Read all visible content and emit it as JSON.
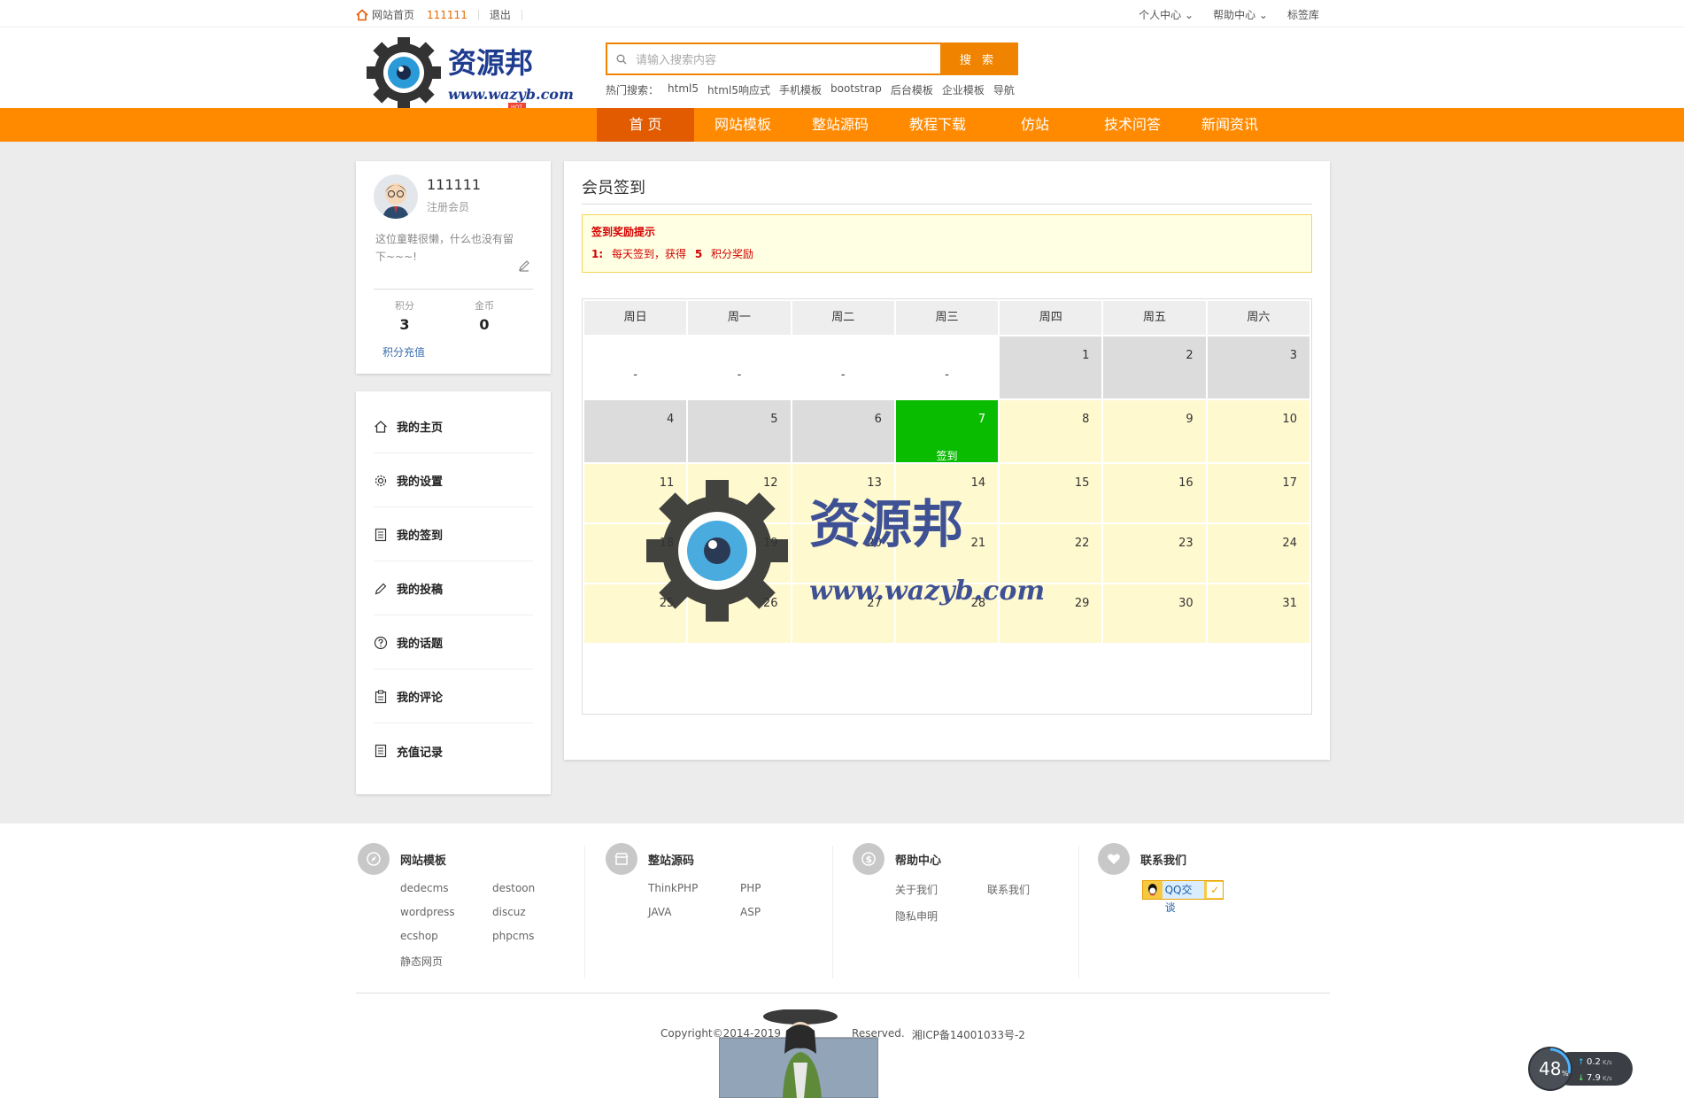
{
  "topbar": {
    "home": "网站首页",
    "user": "111111",
    "logout": "退出",
    "personal_center": "个人中心",
    "help_center": "帮助中心",
    "tag_library": "标签库"
  },
  "search": {
    "placeholder": "请输入搜索内容",
    "button": "搜 索",
    "hot_label": "热门搜索：",
    "hot_terms": [
      "html5",
      "html5响应式",
      "手机模板",
      "bootstrap",
      "后台模板",
      "企业模板",
      "导航"
    ]
  },
  "logo": {
    "text": "资源邦",
    "url_text": "www.wazyb.com",
    "badge": "HOT"
  },
  "nav": [
    "首 页",
    "网站模板",
    "整站源码",
    "教程下载",
    "仿站",
    "技术问答",
    "新闻资讯"
  ],
  "profile": {
    "name": "111111",
    "role": "注册会员",
    "bio": "这位童鞋很懒，什么也没有留下~~~!",
    "points_label": "积分",
    "points": "3",
    "coins_label": "金币",
    "coins": "0",
    "recharge": "积分充值"
  },
  "menu": [
    {
      "label": "我的主页",
      "icon": "home-icon"
    },
    {
      "label": "我的设置",
      "icon": "gear-icon"
    },
    {
      "label": "我的签到",
      "icon": "list-icon"
    },
    {
      "label": "我的投稿",
      "icon": "pencil-icon"
    },
    {
      "label": "我的话题",
      "icon": "question-icon"
    },
    {
      "label": "我的评论",
      "icon": "clipboard-icon"
    },
    {
      "label": "充值记录",
      "icon": "list-icon"
    }
  ],
  "main": {
    "title": "会员签到",
    "tips_title": "签到奖励提示",
    "tips_prefix": "1:",
    "tips_text_a": "每天签到，获得",
    "tips_points": "5",
    "tips_text_b": "积分奖励"
  },
  "calendar": {
    "weekdays": [
      "周日",
      "周一",
      "周二",
      "周三",
      "周四",
      "周五",
      "周六"
    ],
    "rows": [
      [
        {
          "t": "-",
          "s": "empty"
        },
        {
          "t": "-",
          "s": "empty"
        },
        {
          "t": "-",
          "s": "empty"
        },
        {
          "t": "-",
          "s": "empty"
        },
        {
          "t": "1",
          "s": "past"
        },
        {
          "t": "2",
          "s": "past"
        },
        {
          "t": "3",
          "s": "past"
        }
      ],
      [
        {
          "t": "4",
          "s": "past"
        },
        {
          "t": "5",
          "s": "past"
        },
        {
          "t": "6",
          "s": "past"
        },
        {
          "t": "7",
          "s": "today",
          "sign": "签到"
        },
        {
          "t": "8",
          "s": "future"
        },
        {
          "t": "9",
          "s": "future"
        },
        {
          "t": "10",
          "s": "future"
        }
      ],
      [
        {
          "t": "11",
          "s": "future"
        },
        {
          "t": "12",
          "s": "future"
        },
        {
          "t": "13",
          "s": "future"
        },
        {
          "t": "14",
          "s": "future"
        },
        {
          "t": "15",
          "s": "future"
        },
        {
          "t": "16",
          "s": "future"
        },
        {
          "t": "17",
          "s": "future"
        }
      ],
      [
        {
          "t": "18",
          "s": "future"
        },
        {
          "t": "19",
          "s": "future"
        },
        {
          "t": "20",
          "s": "future"
        },
        {
          "t": "21",
          "s": "future"
        },
        {
          "t": "22",
          "s": "future"
        },
        {
          "t": "23",
          "s": "future"
        },
        {
          "t": "24",
          "s": "future"
        }
      ],
      [
        {
          "t": "25",
          "s": "future"
        },
        {
          "t": "26",
          "s": "future"
        },
        {
          "t": "27",
          "s": "future"
        },
        {
          "t": "28",
          "s": "future"
        },
        {
          "t": "29",
          "s": "future"
        },
        {
          "t": "30",
          "s": "future"
        },
        {
          "t": "31",
          "s": "future"
        }
      ]
    ]
  },
  "footer": {
    "templates": {
      "title": "网站模板",
      "links": [
        "dedecms",
        "destoon",
        "wordpress",
        "discuz",
        "ecshop",
        "phpcms",
        "静态网页"
      ]
    },
    "sources": {
      "title": "整站源码",
      "links": [
        "ThinkPHP",
        "PHP",
        "JAVA",
        "ASP"
      ]
    },
    "help": {
      "title": "帮助中心",
      "links": [
        "关于我们",
        "联系我们",
        "隐私申明"
      ]
    },
    "contact": {
      "title": "联系我们",
      "qq": "QQ交谈"
    },
    "copyright": "Copyright©2014-2019",
    "reserved": "Reserved.",
    "icp": "湘ICP备14001033号-2"
  },
  "speed": {
    "percent": "48",
    "unit": "%",
    "up": "0.2",
    "down": "7.9",
    "rate_unit": "K/s"
  },
  "colors": {
    "orange": "#ff8a00",
    "nav_active": "#e35b00",
    "today": "#09bc00",
    "future": "#fff9cf",
    "past": "#dcdcdc"
  }
}
